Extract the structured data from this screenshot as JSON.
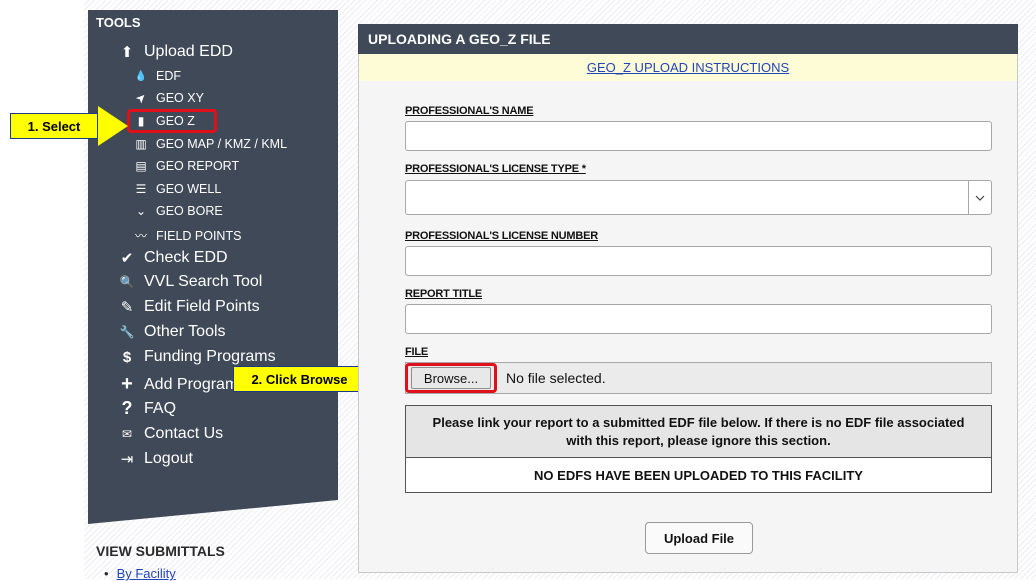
{
  "sidebar": {
    "heading": "TOOLS",
    "items": [
      {
        "icon": "upload-icon",
        "label": "Upload EDD",
        "glyph": "⬆"
      },
      {
        "icon": "droplet-icon",
        "label": "EDF",
        "glyph": "💧"
      },
      {
        "icon": "location-arrow-icon",
        "label": "GEO XY",
        "glyph": "➤"
      },
      {
        "icon": "file-icon",
        "label": "GEO Z",
        "glyph": "▮"
      },
      {
        "icon": "map-icon",
        "label": "GEO MAP / KMZ / KML",
        "glyph": "▥"
      },
      {
        "icon": "report-icon",
        "label": "GEO REPORT",
        "glyph": "▤"
      },
      {
        "icon": "lines-icon",
        "label": "GEO WELL",
        "glyph": "☰"
      },
      {
        "icon": "chevrons-down-icon",
        "label": "GEO BORE",
        "glyph": "⌄"
      },
      {
        "icon": "wave-icon",
        "label": "FIELD POINTS",
        "glyph": "〰"
      },
      {
        "icon": "check-icon",
        "label": "Check EDD",
        "glyph": "✔"
      },
      {
        "icon": "search-icon",
        "label": "VVL Search Tool",
        "glyph": "🔍"
      },
      {
        "icon": "edit-icon",
        "label": "Edit Field Points",
        "glyph": "✎"
      },
      {
        "icon": "wrench-icon",
        "label": "Other Tools",
        "glyph": "🔧"
      },
      {
        "icon": "dollar-icon",
        "label": "Funding Programs",
        "glyph": "$"
      },
      {
        "icon": "plus-icon",
        "label": "Add Programs",
        "glyph": "+"
      },
      {
        "icon": "question-icon",
        "label": "FAQ",
        "glyph": "?"
      },
      {
        "icon": "envelope-icon",
        "label": "Contact Us",
        "glyph": "✉"
      },
      {
        "icon": "logout-icon",
        "label": "Logout",
        "glyph": "⇥"
      }
    ],
    "view_heading": "VIEW SUBMITTALS",
    "view_link": "By Facility"
  },
  "callouts": {
    "select": "1. Select",
    "browse": "2. Click Browse"
  },
  "panel": {
    "title": "UPLOADING A GEO_Z FILE",
    "instructions_link": "GEO_Z UPLOAD INSTRUCTIONS",
    "fields": {
      "name_label": "PROFESSIONAL'S NAME",
      "name_value": "",
      "license_type_label": "PROFESSIONAL'S LICENSE TYPE *",
      "license_type_value": "",
      "license_number_label": "PROFESSIONAL'S LICENSE NUMBER",
      "license_number_value": "",
      "report_title_label": "REPORT TITLE",
      "report_title_value": "",
      "file_label": "FILE",
      "browse_label": "Browse...",
      "file_status": "No file selected."
    },
    "edf_notice": "Please link your report to a submitted EDF file below. If there is no EDF file associated with this report, please ignore this section.",
    "edf_empty": "NO EDFS HAVE BEEN UPLOADED TO THIS FACILITY",
    "upload_button": "Upload File"
  },
  "colors": {
    "sidebar_bg": "#3f4957",
    "callout_fill": "#ffff00",
    "highlight_red": "#e0101a",
    "instructions_bar": "#fdfcd7",
    "link_blue": "#2244bb"
  }
}
